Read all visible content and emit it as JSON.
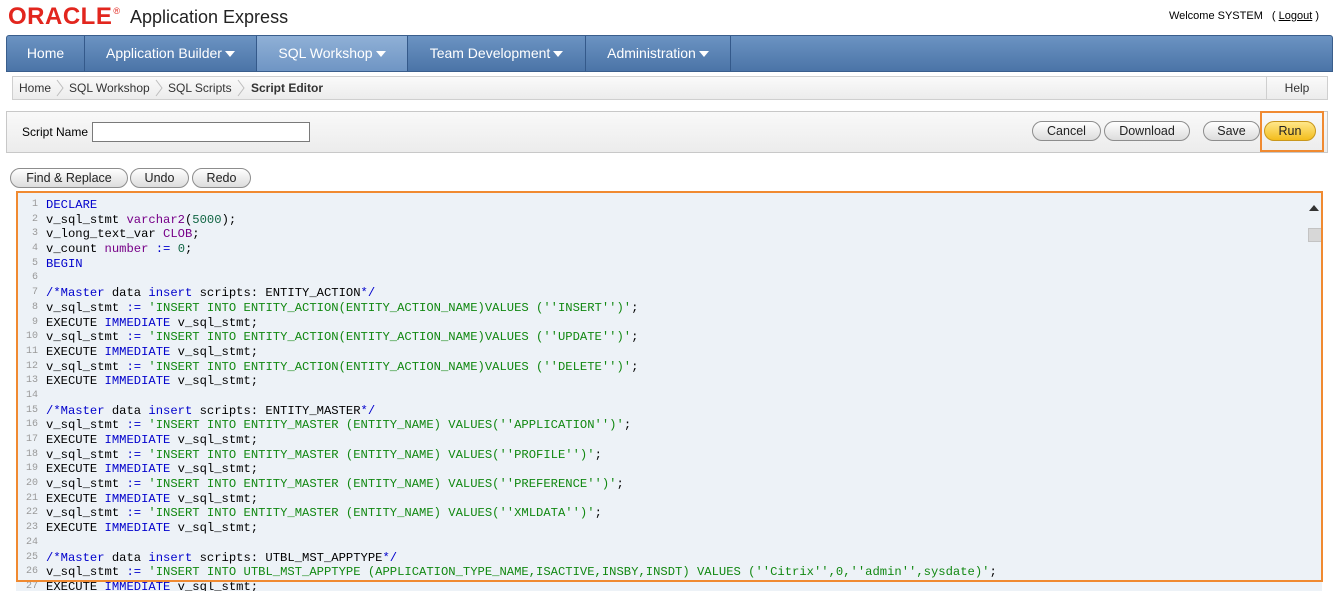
{
  "header": {
    "logo_text": "ORACLE",
    "logo_mark": "®",
    "app_title": "Application Express",
    "welcome": "Welcome SYSTEM",
    "logout_open": "(",
    "logout": "Logout",
    "logout_close": ")"
  },
  "nav": {
    "tabs": [
      {
        "label": "Home"
      },
      {
        "label": "Application Builder"
      },
      {
        "label": "SQL Workshop"
      },
      {
        "label": "Team Development"
      },
      {
        "label": "Administration"
      }
    ],
    "active": "SQL Workshop"
  },
  "breadcrumb": {
    "items": [
      "Home",
      "SQL Workshop",
      "SQL Scripts",
      "Script Editor"
    ],
    "help": "Help"
  },
  "script": {
    "name_label": "Script Name",
    "name_value": "",
    "buttons": {
      "cancel": "Cancel",
      "download": "Download",
      "save": "Save",
      "run": "Run"
    }
  },
  "editor_toolbar": {
    "find_replace": "Find & Replace",
    "undo": "Undo",
    "redo": "Redo"
  },
  "code_lines": [
    "DECLARE",
    "v_sql_stmt varchar2(5000);",
    "v_long_text_var CLOB;",
    "v_count number := 0;",
    "BEGIN",
    "",
    "/*Master data insert scripts: ENTITY_ACTION*/",
    "v_sql_stmt := 'INSERT INTO ENTITY_ACTION(ENTITY_ACTION_NAME)VALUES (''INSERT'')';",
    "EXECUTE IMMEDIATE v_sql_stmt;",
    "v_sql_stmt := 'INSERT INTO ENTITY_ACTION(ENTITY_ACTION_NAME)VALUES (''UPDATE'')';",
    "EXECUTE IMMEDIATE v_sql_stmt;",
    "v_sql_stmt := 'INSERT INTO ENTITY_ACTION(ENTITY_ACTION_NAME)VALUES (''DELETE'')';",
    "EXECUTE IMMEDIATE v_sql_stmt;",
    "",
    "/*Master data insert scripts: ENTITY_MASTER*/",
    "v_sql_stmt := 'INSERT INTO ENTITY_MASTER (ENTITY_NAME) VALUES(''APPLICATION'')';",
    "EXECUTE IMMEDIATE v_sql_stmt;",
    "v_sql_stmt := 'INSERT INTO ENTITY_MASTER (ENTITY_NAME) VALUES(''PROFILE'')';",
    "EXECUTE IMMEDIATE v_sql_stmt;",
    "v_sql_stmt := 'INSERT INTO ENTITY_MASTER (ENTITY_NAME) VALUES(''PREFERENCE'')';",
    "EXECUTE IMMEDIATE v_sql_stmt;",
    "v_sql_stmt := 'INSERT INTO ENTITY_MASTER (ENTITY_NAME) VALUES(''XMLDATA'')';",
    "EXECUTE IMMEDIATE v_sql_stmt;",
    "",
    "/*Master data insert scripts: UTBL_MST_APPTYPE*/",
    "v_sql_stmt := 'INSERT INTO UTBL_MST_APPTYPE (APPLICATION_TYPE_NAME,ISACTIVE,INSBY,INSDT) VALUES (''Citrix'',0,''admin'',sysdate)';",
    "EXECUTE IMMEDIATE v_sql_stmt;"
  ],
  "colors": {
    "nav_blue": "#4b74a7",
    "highlight_orange": "#f08a31",
    "oracle_red": "#e2261e",
    "editor_bg": "#edf2f7"
  },
  "icons": [
    "chevron-down-icon",
    "breadcrumb-separator-icon",
    "scroll-up-arrow-icon"
  ]
}
